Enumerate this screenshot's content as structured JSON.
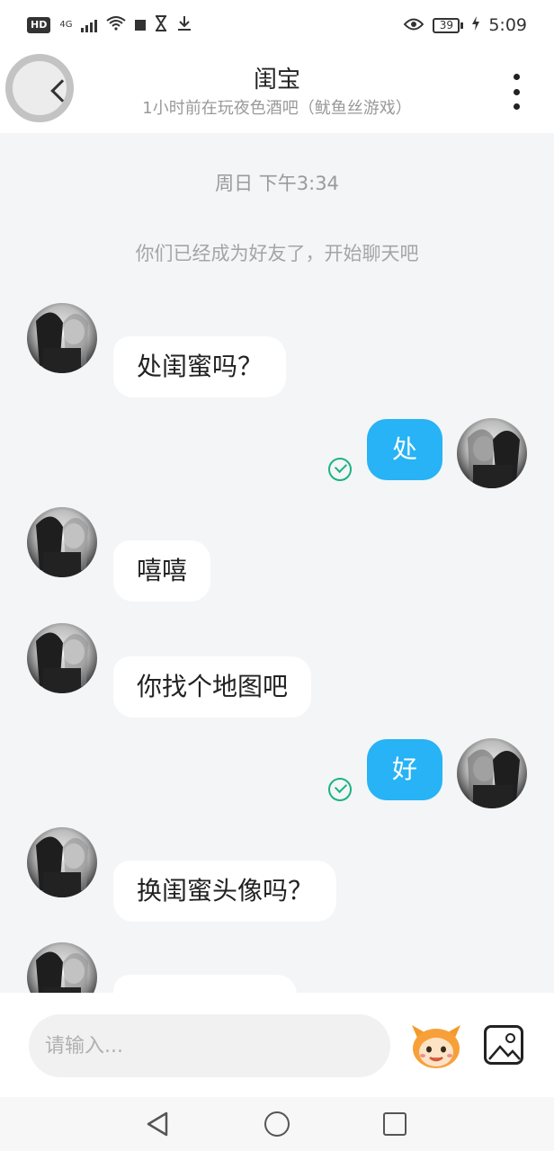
{
  "status_bar": {
    "hd": "HD",
    "network": "4G",
    "battery": "39",
    "time": "5:09"
  },
  "header": {
    "title": "闺宝",
    "subtitle": "1小时前在玩夜色酒吧（鱿鱼丝游戏）"
  },
  "chat": {
    "timestamp": "周日 下午3:34",
    "system_note": "你们已经成为好友了，开始聊天吧",
    "messages": [
      {
        "direction": "in",
        "text": "处闺蜜吗？"
      },
      {
        "direction": "out",
        "text": "处",
        "status": "read"
      },
      {
        "direction": "in",
        "text": "嘻嘻"
      },
      {
        "direction": "in",
        "text": "你找个地图吧"
      },
      {
        "direction": "out",
        "text": "好",
        "status": "read"
      },
      {
        "direction": "in",
        "text": "换闺蜜头像吗？"
      },
      {
        "direction": "in",
        "text": ""
      }
    ]
  },
  "input": {
    "placeholder": "请输入..."
  },
  "icons": {
    "back": "chevron-left-icon",
    "more": "more-vertical-icon",
    "emoji": "emoji-mascot-icon",
    "image": "image-icon",
    "read": "check-circle-icon"
  },
  "colors": {
    "accent": "#27b3f5",
    "read_check": "#1cb37d",
    "chat_background": "#f3f5f6"
  }
}
